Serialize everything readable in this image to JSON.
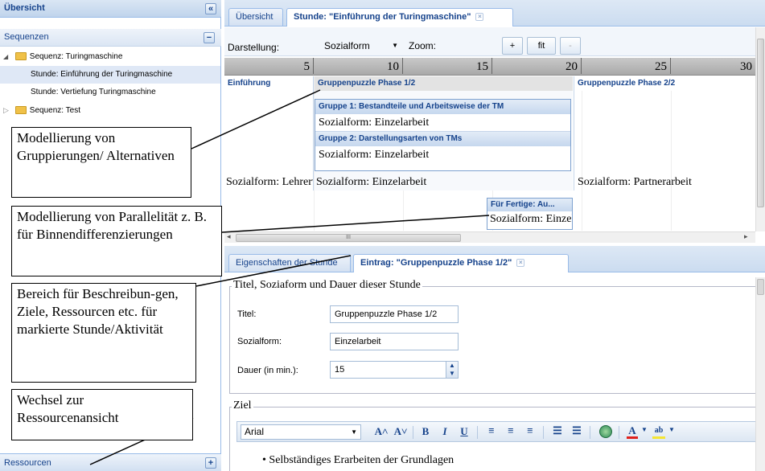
{
  "left_panel": {
    "title": "Übersicht",
    "collapse_glyph": "«",
    "section_title": "Sequenzen",
    "section_toggle": "−",
    "tree": [
      {
        "label": "Sequenz: Turingmaschine",
        "expander": "◢"
      },
      {
        "label": "Stunde: Einführung der Turingmaschine"
      },
      {
        "label": "Stunde: Vertiefung Turingmaschine"
      },
      {
        "label": "Sequenz: Test",
        "expander": "▷"
      }
    ],
    "footer_label": "Ressourcen",
    "footer_toggle": "+"
  },
  "callouts": {
    "grouping": "Modellierung von Gruppierungen/ Alternativen",
    "parallel": "Modellierung von Parallelität z. B. für Binnendifferenzierungen",
    "description": "Bereich für Beschreibun-gen, Ziele, Ressourcen etc. für markierte Stunde/Aktivität",
    "switch": "Wechsel zur Ressourcenansicht"
  },
  "top_tabs": [
    {
      "label": "Übersicht"
    },
    {
      "label": "Stunde: \"Einführung der Turingmaschine\"",
      "close": "×"
    }
  ],
  "toolbar": {
    "display_label": "Darstellung:",
    "display_value": "Sozialform",
    "zoom_label": "Zoom:",
    "zoom_in": "+",
    "zoom_fit": "fit",
    "zoom_out": "-"
  },
  "timeline": [
    "5",
    "10",
    "15",
    "20",
    "25",
    "30"
  ],
  "activities": {
    "einfuehrung": {
      "title": "Einführung",
      "sozialform": "Sozialform: Lehrervortrag"
    },
    "phase1": {
      "title": "Gruppenpuzzle Phase 1/2",
      "sozialform": "Sozialform: Einzelarbeit"
    },
    "gruppe1": {
      "title": "Gruppe 1: Bestandteile und Arbeitsweise der TM",
      "sozialform": "Sozialform: Einzelarbeit"
    },
    "gruppe2": {
      "title": "Gruppe 2: Darstellungsarten von TMs",
      "sozialform": "Sozialform: Einzelarbeit"
    },
    "phase2": {
      "title": "Gruppenpuzzle Phase 2/2",
      "sozialform": "Sozialform: Partnerarbeit"
    },
    "fertige": {
      "title": "Für Fertige: Au...",
      "sozialform": "Sozialform: Einzelarbeit"
    }
  },
  "hscroll_grip": "III",
  "bottom_tabs": [
    {
      "label": "Eigenschaften der Stunde"
    },
    {
      "label": "Eintrag: \"Gruppenpuzzle Phase 1/2\"",
      "close": "×"
    }
  ],
  "form": {
    "legend": "Titel, Soziaform und Dauer dieser Stunde",
    "title_label": "Titel:",
    "title_value": "Gruppenpuzzle Phase 1/2",
    "social_label": "Sozialform:",
    "social_value": "Einzelarbeit",
    "duration_label": "Dauer (in min.):",
    "duration_value": "15"
  },
  "goal": {
    "legend": "Ziel",
    "font": "Arial",
    "bullet": "Selbständiges Erarbeiten der Grundlagen",
    "tools": {
      "grow": "A˄",
      "shrink": "A˅",
      "bold": "B",
      "italic": "I",
      "underline": "U",
      "font_color": "A",
      "highlight": "ab"
    }
  },
  "colors": {
    "header_text": "#15428b",
    "border": "#99bbe8",
    "selection": "#dfe8f6"
  }
}
